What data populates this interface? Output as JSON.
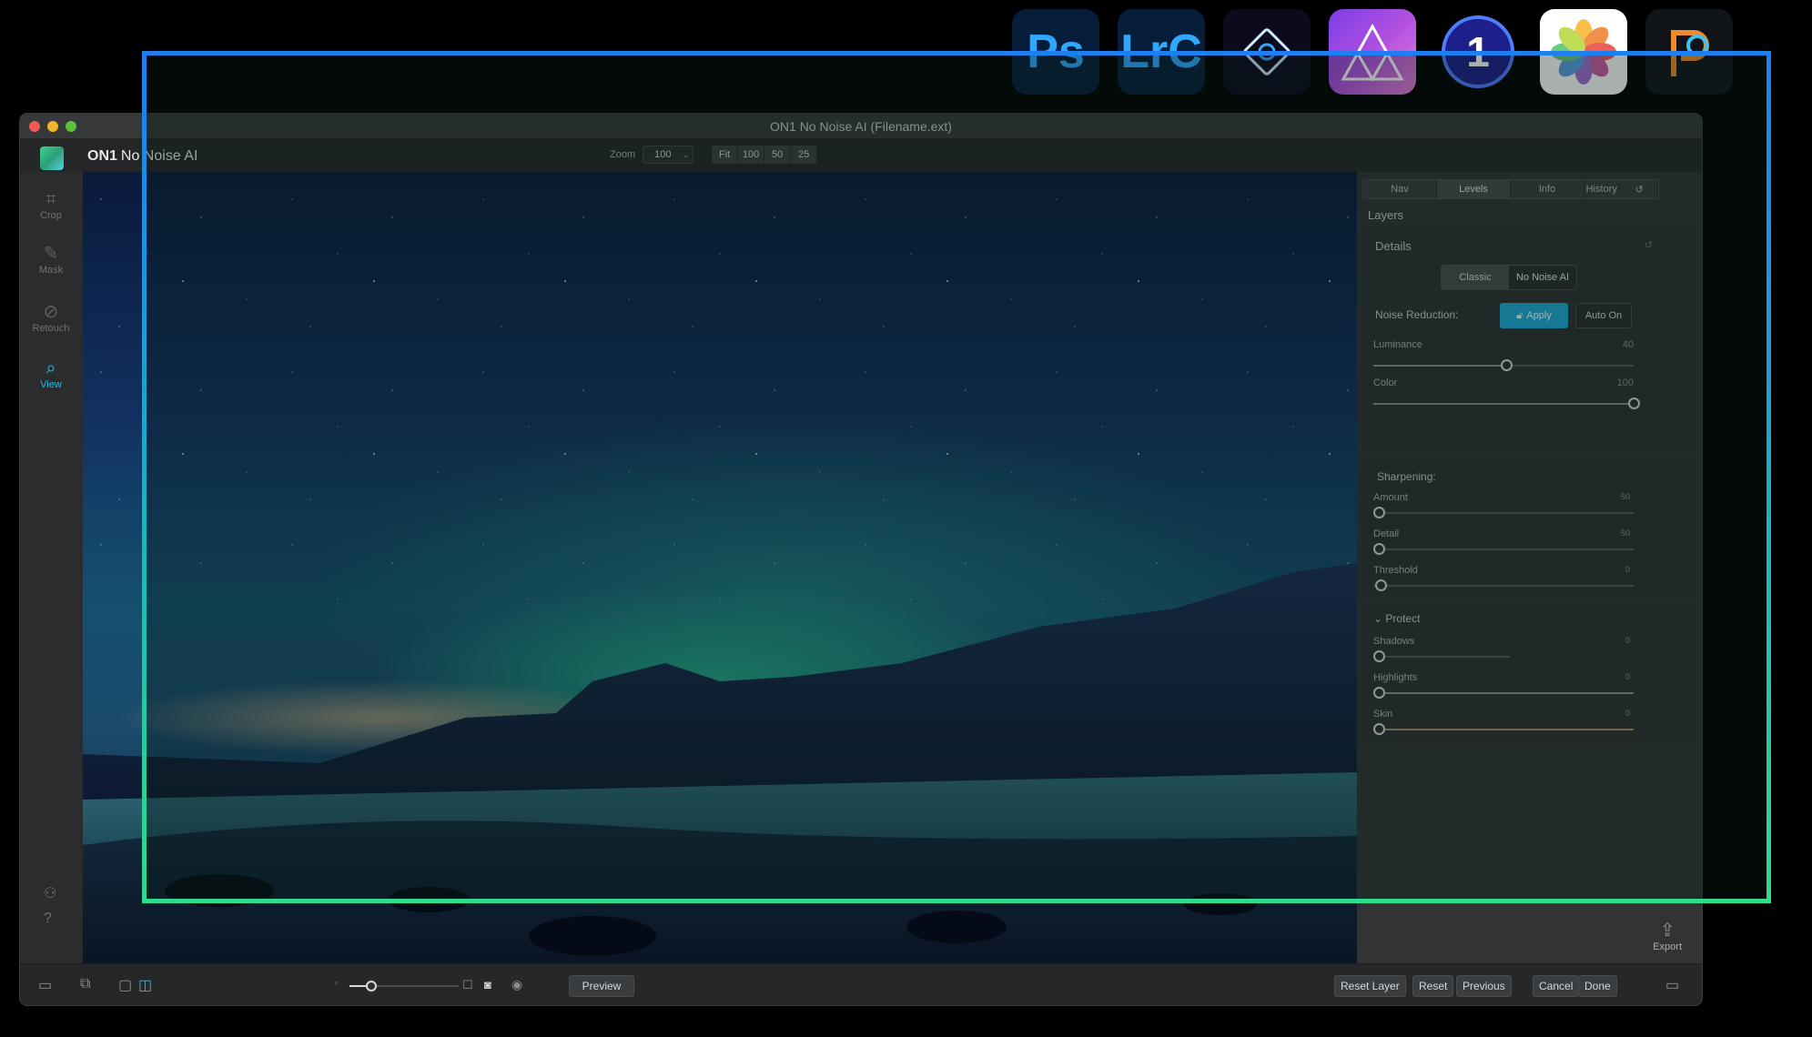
{
  "window": {
    "title": "ON1 No Noise AI (Filename.ext)"
  },
  "app": {
    "brand": "ON1",
    "product": "No Noise AI"
  },
  "zoom": {
    "label": "Zoom",
    "value": "100",
    "presets": [
      "Fit",
      "100",
      "50",
      "25"
    ]
  },
  "tools": [
    {
      "name": "crop",
      "label": "Crop",
      "icon": "crop-icon"
    },
    {
      "name": "mask",
      "label": "Mask",
      "icon": "brush-icon"
    },
    {
      "name": "retouch",
      "label": "Retouch",
      "icon": "retouch-icon"
    },
    {
      "name": "view",
      "label": "View",
      "icon": "magnifier-icon",
      "active": true
    }
  ],
  "panel": {
    "tabs": [
      "Nav",
      "Levels",
      "Info",
      "History"
    ],
    "active_tab": "Levels",
    "layers_label": "Layers",
    "details_label": "Details",
    "modes": [
      "Classic",
      "No Noise AI"
    ],
    "active_mode": "No Noise AI",
    "noise_reduction_label": "Noise Reduction:",
    "apply_label": "Apply",
    "auto_on_label": "Auto On",
    "luminance": {
      "label": "Luminance",
      "value": 40
    },
    "color": {
      "label": "Color",
      "value": 100
    },
    "sharpening_label": "Sharpening:",
    "amount": {
      "label": "Amount",
      "value": 50
    },
    "detail": {
      "label": "Detail",
      "value": 50
    },
    "threshold": {
      "label": "Threshold",
      "value": 0
    },
    "protect_label": "Protect",
    "shadows": {
      "label": "Shadows",
      "value": 0
    },
    "highlights": {
      "label": "Highlights",
      "value": 0
    },
    "skin": {
      "label": "Skin",
      "value": 0
    }
  },
  "bottom": {
    "preview_label": "Preview",
    "reset_layer_label": "Reset Layer",
    "reset_label": "Reset",
    "previous_label": "Previous",
    "cancel_label": "Cancel",
    "done_label": "Done",
    "export_label": "Export"
  },
  "hosts": [
    "Ps",
    "LrC"
  ],
  "colors": {
    "accent": "#1fa9d6",
    "frame_top": "#1e7ff0",
    "frame_bottom": "#2ddc8c"
  }
}
